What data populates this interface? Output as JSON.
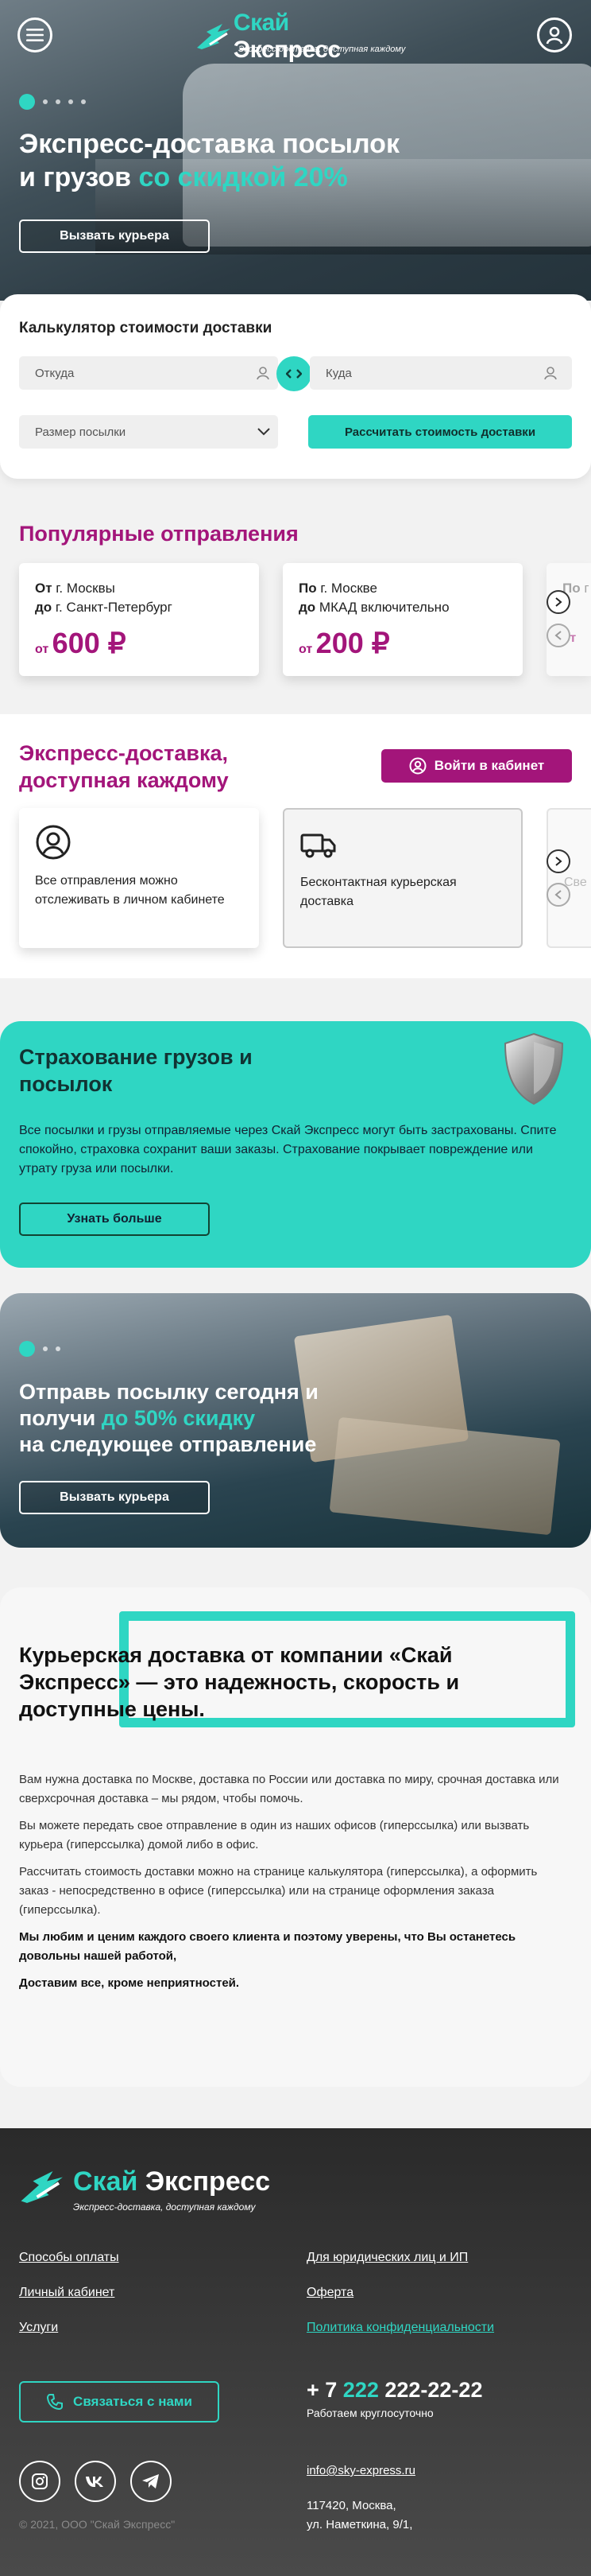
{
  "header": {
    "brand_part1": "Скай",
    "brand_part2": "Экспресс",
    "tagline": "Экспресс-доставка, доступная каждому",
    "menu_icon": "menu-icon",
    "account_icon": "user-icon"
  },
  "hero": {
    "title_line1": "Экспресс-доставка посылок",
    "title_line2_plain": "и грузов ",
    "title_line2_accent": "со скидкой 20%",
    "cta": "Вызвать курьера",
    "slides_total": 5,
    "active_slide": 1
  },
  "calculator": {
    "title": "Калькулятор стоимости доставки",
    "from_placeholder": "Откуда",
    "to_placeholder": "Куда",
    "size_placeholder": "Размер посылки",
    "submit": "Рассчитать стоимость доставки",
    "swap_symbol": "<>"
  },
  "popular": {
    "title": "Популярные отправления",
    "cards": [
      {
        "prefix1": "От",
        "city1": " г. Москвы",
        "prefix2": "до",
        "city2": " г. Санкт-Петербург",
        "price_prefix": "от",
        "price": "600 ₽"
      },
      {
        "prefix1": "По",
        "city1": " г. Москве",
        "prefix2": "до",
        "city2": " МКАД включительно",
        "price_prefix": "от",
        "price": "200 ₽"
      },
      {
        "prefix1": "По",
        "city1": " г",
        "prefix2": "",
        "city2": "",
        "price_prefix": "от",
        "price": ""
      }
    ]
  },
  "features": {
    "title_line1": "Экспресс-доставка,",
    "title_line2": "доступная каждому",
    "cabinet_button": "Войти в кабинет",
    "cards": [
      {
        "icon": "user-circle-icon",
        "text": "Все отправления можно отслеживать в личном кабинете"
      },
      {
        "icon": "truck-icon",
        "text": "Бесконтактная курьерская доставка"
      },
      {
        "icon": "",
        "text": "Све"
      }
    ]
  },
  "insurance": {
    "title": "Страхование грузов и посылок",
    "text": "Все посылки и грузы отправляемые через Скай Экспресс могут быть застрахованы. Спите спокойно, страховка сохранит ваши заказы. Страхование покрывает повреждение или утрату груза или посылки.",
    "button": "Узнать больше",
    "icon": "shield-icon"
  },
  "promo": {
    "line1": "Отправь посылку сегодня и",
    "line2_plain": "получи ",
    "line2_accent": "до 50% скидку",
    "line3": "на следующее отправление",
    "cta": "Вызвать курьера",
    "slides_total": 3,
    "active_slide": 1
  },
  "about": {
    "title": "Курьерская доставка от компании «Скай Экспресс» — это надежность, скорость и доступные цены.",
    "p1": "Вам нужна доставка по Москве, доставка по России или доставка по миру, срочная доставка или сверхсрочная доставка – мы рядом, чтобы помочь.",
    "p2": "Вы можете передать свое отправление в один из наших офисов (гиперссылка) или вызвать курьера (гиперссылка) домой либо в офис.",
    "p3": "Рассчитать стоимость доставки можно на странице калькулятора (гиперссылка), а оформить заказ - непосредственно в офисе (гиперссылка) или на странице оформления заказа (гиперссылка).",
    "p4": "Мы любим и ценим каждого своего клиента и поэтому уверены, что Вы останетесь довольны нашей работой,",
    "p5": "Доставим все, кроме неприятностей."
  },
  "footer": {
    "brand_part1": "Скай",
    "brand_part2": "Экспресс",
    "tagline": "Экспресс-доставка, доступная каждому",
    "links_left": [
      "Способы оплаты",
      "Личный кабинет",
      "Услуги"
    ],
    "links_right": [
      "Для юридических лиц и ИП",
      "Оферта",
      "Политика конфиденциальности"
    ],
    "contact_button": "Связаться с нами",
    "phone_prefix": "+ 7 ",
    "phone_code": "222",
    "phone_number": " 222-22-22",
    "hours": "Работаем круглосуточно",
    "email": "info@sky-express.ru",
    "address_line1": "117420, Москва,",
    "address_line2": "ул. Наметкина, 9/1,",
    "copyright": "© 2021, ООО \"Скай Экспресс\"",
    "socials": [
      "instagram-icon",
      "vk-icon",
      "telegram-icon"
    ]
  },
  "colors": {
    "accent": "#2fd6c3",
    "brand": "#a3157a",
    "footer_bg": "#2a2a2a"
  }
}
